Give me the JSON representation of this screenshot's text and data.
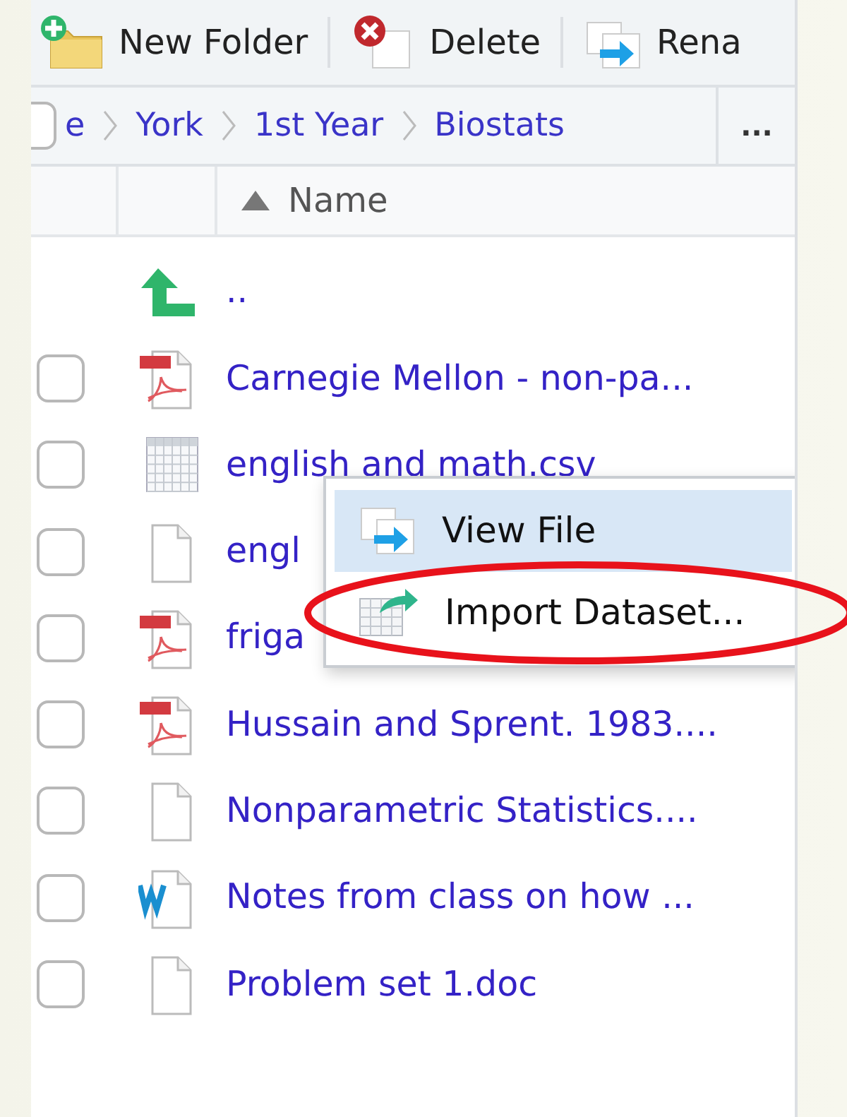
{
  "toolbar": [
    {
      "label": "New Folder",
      "kind": "new-folder"
    },
    {
      "label": "Delete",
      "kind": "delete"
    },
    {
      "label": "Rena",
      "kind": "rename"
    }
  ],
  "breadcrumb": {
    "checkbox": {
      "checked": false
    },
    "items": [
      "e",
      "York",
      "1st Year",
      "Biostats"
    ],
    "more": "..."
  },
  "columns": [
    {
      "label": "Name",
      "sorted_ascending": true
    }
  ],
  "files": [
    {
      "name": "..",
      "kind": "up"
    },
    {
      "name": "Carnegie Mellon - non-pa...",
      "kind": "pdf",
      "checked": false
    },
    {
      "name": "english and math.csv",
      "kind": "table",
      "checked": false
    },
    {
      "name": "engl",
      "kind": "file",
      "checked": false
    },
    {
      "name": "friga",
      "kind": "pdf",
      "checked": false
    },
    {
      "name": "Hussain and Sprent. 1983....",
      "kind": "pdf",
      "checked": false
    },
    {
      "name": "Nonparametric Statistics....",
      "kind": "file",
      "checked": false
    },
    {
      "name": "Notes from class on how ...",
      "kind": "word",
      "checked": false
    },
    {
      "name": "Problem set 1.doc",
      "kind": "file",
      "checked": false
    }
  ],
  "context_menu": {
    "items": [
      {
        "label": "View File",
        "kind": "view",
        "selected": true,
        "circled": false
      },
      {
        "label": "Import Dataset...",
        "kind": "import",
        "selected": false,
        "circled": true
      }
    ]
  }
}
